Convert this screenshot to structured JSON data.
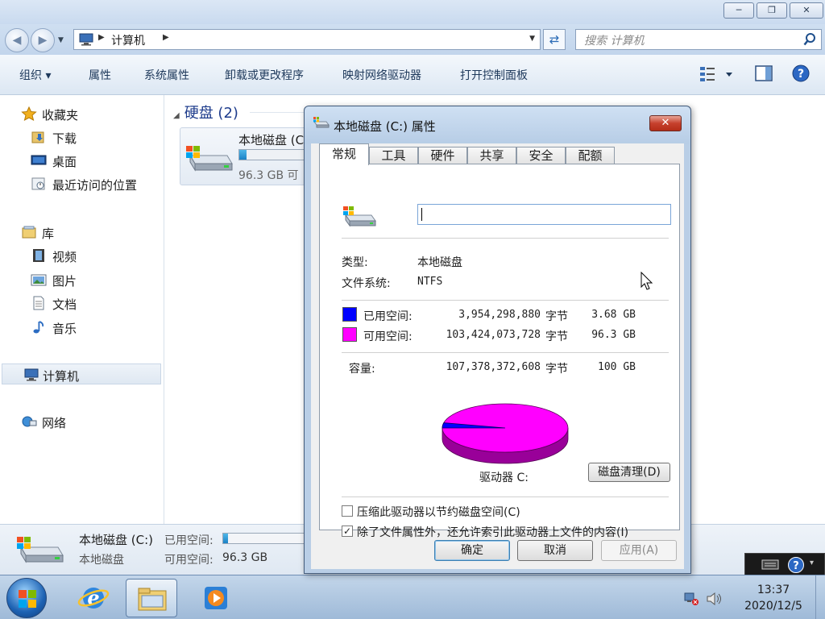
{
  "window": {
    "controls": {
      "minimize": "─",
      "maximize": "❐",
      "close": "✕"
    }
  },
  "address": {
    "crumb": "计算机",
    "search_placeholder": "搜索 计算机"
  },
  "toolbar": {
    "organize": "组织 ▾",
    "properties": "属性",
    "system_properties": "系统属性",
    "uninstall": "卸载或更改程序",
    "map_drive": "映射网络驱动器",
    "control_panel": "打开控制面板"
  },
  "navpane": {
    "favorites": "收藏夹",
    "downloads": "下载",
    "desktop": "桌面",
    "recent": "最近访问的位置",
    "libraries": "库",
    "videos": "视频",
    "pictures": "图片",
    "documents": "文档",
    "music": "音乐",
    "computer": "计算机",
    "network": "网络"
  },
  "content": {
    "group_header": "硬盘 (2)",
    "drive_name": "本地磁盘 (C",
    "drive_free": "96.3 GB 可"
  },
  "details": {
    "name": "本地磁盘 (C:)",
    "type": "本地磁盘",
    "used_label": "已用空间:",
    "free_label": "可用空间:",
    "free_value": "96.3 GB",
    "used_fraction": 0.0343
  },
  "taskbar": {
    "time": "13:37",
    "date": "2020/12/5"
  },
  "dialog": {
    "title": "本地磁盘 (C:) 属性",
    "close": "✕",
    "tabs": [
      "常规",
      "工具",
      "硬件",
      "共享",
      "安全",
      "配额"
    ],
    "volume_label_value": "",
    "type_label": "类型:",
    "type_value": "本地磁盘",
    "fs_label": "文件系统:",
    "fs_value": "NTFS",
    "used_label": "已用空间:",
    "used_bytes": "3,954,298,880",
    "used_unit": "字节",
    "used_gb": "3.68 GB",
    "free_label": "可用空间:",
    "free_bytes": "103,424,073,728",
    "free_unit": "字节",
    "free_gb": "96.3 GB",
    "capacity_label": "容量:",
    "capacity_bytes": "107,378,372,608",
    "capacity_unit": "字节",
    "capacity_gb": "100 GB",
    "drive_label": "驱动器 C:",
    "cleanup_button": "磁盘清理(D)",
    "compress_label": "压缩此驱动器以节约磁盘空间(C)",
    "compress_checked": false,
    "index_label": "除了文件属性外，还允许索引此驱动器上文件的内容(I)",
    "index_checked": true,
    "ok": "确定",
    "cancel": "取消",
    "apply": "应用(A)",
    "colors": {
      "used": "#0000ff",
      "free": "#ff00ff"
    }
  }
}
